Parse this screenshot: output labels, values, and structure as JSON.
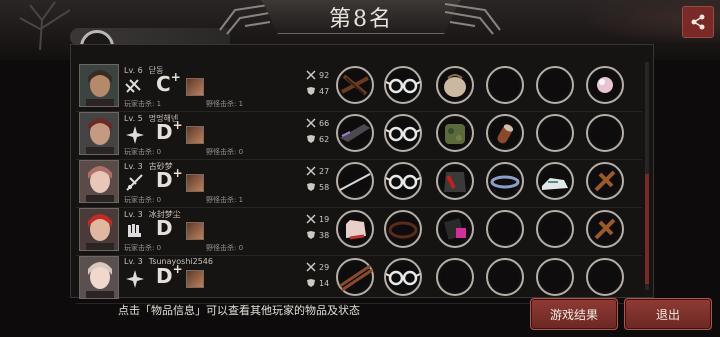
{
  "title": "第8名",
  "players": [
    {
      "level": "Lv. 6",
      "name": "닫동",
      "grade": "C",
      "grade_plus": "+",
      "player_kills_label": "玩家击杀: 1",
      "monster_kills_label": "野怪击杀: 1",
      "kills": "92",
      "armor": "47",
      "items": [
        "crossbow",
        "glasses",
        "sack",
        "empty",
        "empty",
        "pearl"
      ]
    },
    {
      "level": "Lv. 5",
      "name": "멍멍해넨",
      "grade": "D",
      "grade_plus": "+",
      "player_kills_label": "玩家击杀: 0",
      "monster_kills_label": "野怪击杀: 0",
      "kills": "66",
      "armor": "62",
      "items": [
        "shuriken-blade",
        "glasses",
        "camo-bag",
        "bullet",
        "empty",
        "empty"
      ]
    },
    {
      "level": "Lv. 3",
      "name": "古砂梦",
      "grade": "D",
      "grade_plus": "+",
      "player_kills_label": "玩家击杀: 0",
      "monster_kills_label": "野怪击杀: 1",
      "kills": "27",
      "armor": "58",
      "items": [
        "needle",
        "glasses",
        "red-vest",
        "bracelet",
        "sneakers",
        "wood-cross"
      ]
    },
    {
      "level": "Lv. 3",
      "name": "冰封梦尘",
      "grade": "D",
      "grade_plus": "",
      "player_kills_label": "玩家击杀: 0",
      "monster_kills_label": "野怪击杀: 0",
      "kills": "19",
      "armor": "38",
      "items": [
        "glove",
        "ring",
        "pink-box",
        "empty",
        "empty",
        "wood-cross"
      ]
    },
    {
      "level": "Lv. 3",
      "name": "Tsunayoshi2546",
      "grade": "D",
      "grade_plus": "+",
      "player_kills_label": "",
      "monster_kills_label": "",
      "kills": "29",
      "armor": "14",
      "items": [
        "chopsticks",
        "glasses",
        "empty",
        "empty",
        "empty",
        "empty"
      ]
    }
  ],
  "footer_hint": "点击「物品信息」可以查看其他玩家的物品及状态",
  "buttons": {
    "results": "游戏结果",
    "exit": "退出"
  },
  "colors": {
    "accent": "#7a2a26",
    "button": "#8f3a35",
    "ring": "#b6afa8"
  }
}
